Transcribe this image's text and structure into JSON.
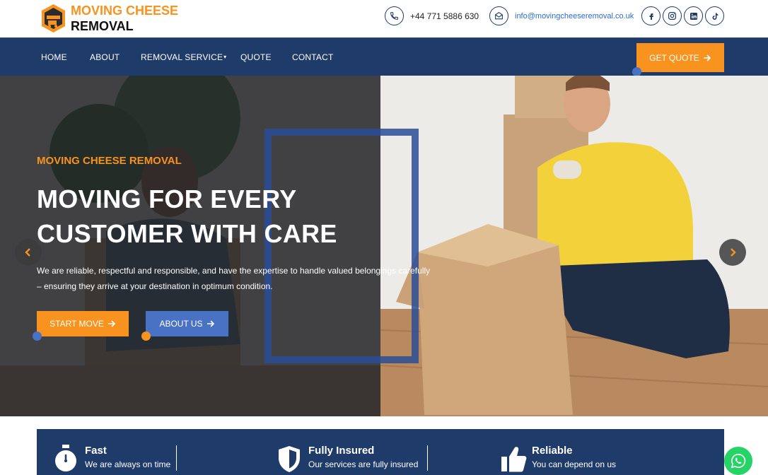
{
  "header": {
    "logo_line1": "MOVING CHEESE",
    "logo_line2": "REMOVAL",
    "phone": "+44 771 5886 630",
    "email": "info@movingcheeseremoval.co.uk",
    "socials": [
      "facebook-icon",
      "instagram-icon",
      "linkedin-icon",
      "tiktok-icon"
    ]
  },
  "nav": {
    "items": [
      {
        "label": "HOME"
      },
      {
        "label": "ABOUT"
      },
      {
        "label": "REMOVAL SERVICE",
        "caret": "▾"
      },
      {
        "label": "QUOTE"
      },
      {
        "label": "CONTACT"
      }
    ],
    "cta_label": "GET QUOTE"
  },
  "hero": {
    "kicker": "MOVING CHEESE REMOVAL",
    "title": "MOVING FOR EVERY CUSTOMER WITH CARE",
    "description": "We are reliable, respectful and responsible, and have the expertise to handle valued belongings carefully – ensuring they arrive at your destination in optimum condition.",
    "primary_button": "START MOVE",
    "secondary_button": "ABOUT US"
  },
  "features": [
    {
      "title": "Fast",
      "desc": "We are always on time",
      "icon": "stopwatch-icon"
    },
    {
      "title": "Fully Insured",
      "desc": "Our services are fully insured",
      "icon": "shield-icon"
    },
    {
      "title": "Reliable",
      "desc": "You can depend on us",
      "icon": "thumbs-up-icon"
    }
  ],
  "colors": {
    "navy": "#1f3b69",
    "orange": "#f7931e",
    "blue": "#4a72c4",
    "whatsapp": "#25d366"
  }
}
